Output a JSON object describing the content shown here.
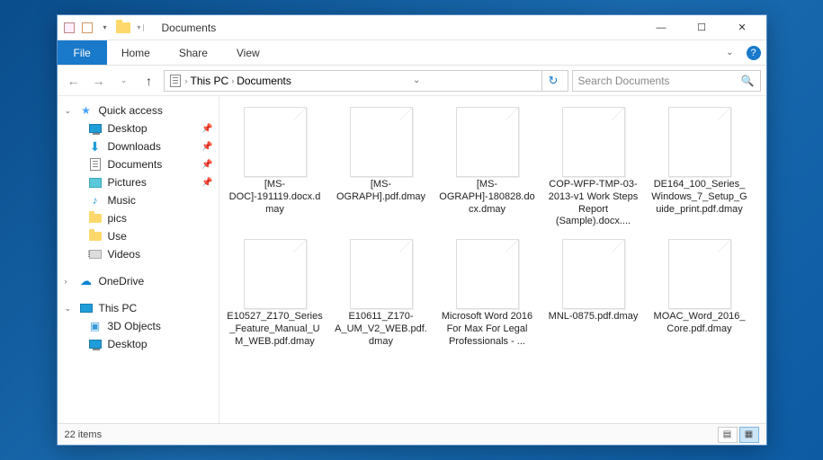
{
  "window": {
    "title": "Documents",
    "minimize": "—",
    "maximize": "☐",
    "close": "✕"
  },
  "ribbon": {
    "file": "File",
    "tabs": [
      "Home",
      "Share",
      "View"
    ]
  },
  "breadcrumb": {
    "root": "This PC",
    "current": "Documents"
  },
  "search": {
    "placeholder": "Search Documents"
  },
  "sidebar": {
    "quick_access": "Quick access",
    "items": [
      {
        "label": "Desktop",
        "pinned": true,
        "icon": "desktop"
      },
      {
        "label": "Downloads",
        "pinned": true,
        "icon": "downloads"
      },
      {
        "label": "Documents",
        "pinned": true,
        "icon": "doc"
      },
      {
        "label": "Pictures",
        "pinned": true,
        "icon": "picture"
      },
      {
        "label": "Music",
        "pinned": false,
        "icon": "music"
      },
      {
        "label": "pics",
        "pinned": false,
        "icon": "folder"
      },
      {
        "label": "Use",
        "pinned": false,
        "icon": "folder"
      },
      {
        "label": "Videos",
        "pinned": false,
        "icon": "video"
      }
    ],
    "onedrive": "OneDrive",
    "this_pc": "This PC",
    "pc_items": [
      {
        "label": "3D Objects",
        "icon": "3d"
      },
      {
        "label": "Desktop",
        "icon": "desktop"
      }
    ]
  },
  "files": [
    {
      "name": "[MS-DOC]-191119.docx.dmay"
    },
    {
      "name": "[MS-OGRAPH].pdf.dmay"
    },
    {
      "name": "[MS-OGRAPH]-180828.docx.dmay"
    },
    {
      "name": "COP-WFP-TMP-03-2013-v1 Work Steps Report (Sample).docx...."
    },
    {
      "name": "DE164_100_Series_Windows_7_Setup_Guide_print.pdf.dmay"
    },
    {
      "name": "E10527_Z170_Series_Feature_Manual_UM_WEB.pdf.dmay"
    },
    {
      "name": "E10611_Z170-A_UM_V2_WEB.pdf.dmay"
    },
    {
      "name": "Microsoft Word 2016 For Max For Legal Professionals - ..."
    },
    {
      "name": "MNL-0875.pdf.dmay"
    },
    {
      "name": "MOAC_Word_2016_Core.pdf.dmay"
    }
  ],
  "status": {
    "count": "22 items"
  }
}
